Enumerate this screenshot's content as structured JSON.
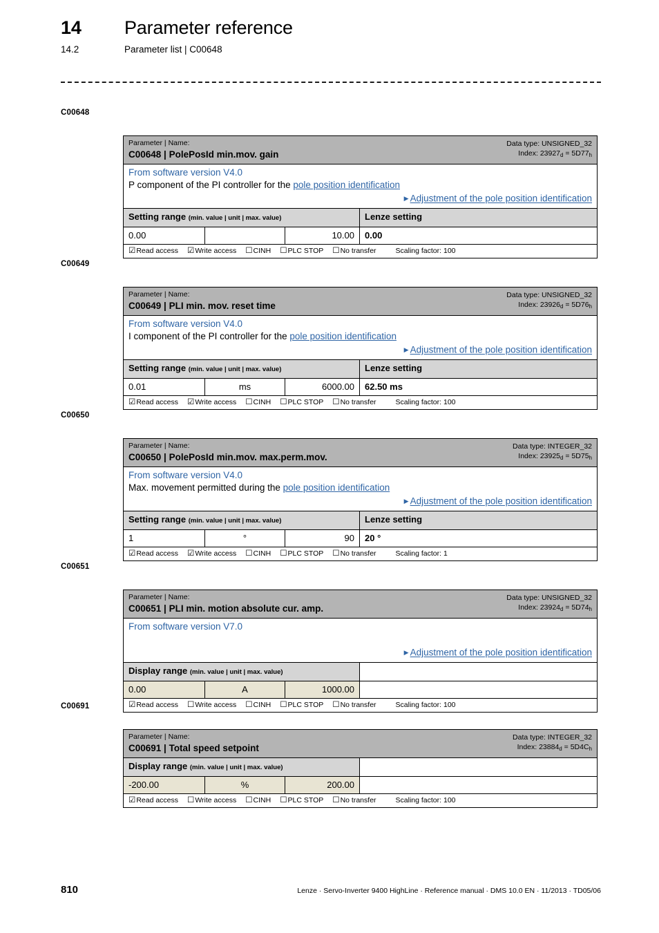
{
  "header": {
    "chapter_number": "14",
    "chapter_title": "Parameter reference",
    "section_number": "14.2",
    "section_title": "Parameter list | C00648"
  },
  "labels": {
    "parameter_name_caption": "Parameter | Name:",
    "setting_range_title": "Setting range",
    "display_range_title": "Display range",
    "range_note": "(min. value | unit | max. value)",
    "lenze_setting_title": "Lenze setting",
    "read_access": "Read access",
    "write_access": "Write access",
    "cinh": "CINH",
    "plc_stop": "PLC STOP",
    "no_transfer": "No transfer",
    "checked_box": "☑",
    "unchecked_box": "☐",
    "link_arrow": "▶"
  },
  "colors": {
    "title_band": "#b4b4b4",
    "range_header": "#d5d5d5",
    "display_range_cell": "#e8e4d3",
    "link_blue": "#2e64a5"
  },
  "parameters": [
    {
      "margin_label": "C00648",
      "code": "C00648",
      "name": "PolePosId min.mov. gain",
      "data_type": "Data type: UNSIGNED_32",
      "index_prefix": "Index: ",
      "index_dec": "23927",
      "index_dec_sub": "d",
      "index_eq": " = ",
      "index_hex": "5D77",
      "index_hex_sub": "h",
      "software_version": "From software version V4.0",
      "description_pre": "P component of the PI controller for the ",
      "description_link": "pole position identification",
      "see_also": "Adjustment of the pole position identification",
      "range_kind": "setting",
      "range_title": "Setting range",
      "min": "0.00",
      "unit": "",
      "max": "10.00",
      "lenze_setting": "0.00",
      "read_access": true,
      "write_access": true,
      "cinh": false,
      "plc_stop": false,
      "no_transfer": false,
      "scaling": "Scaling factor: 100"
    },
    {
      "margin_label": "C00649",
      "code": "C00649",
      "name": "PLI min. mov. reset time",
      "data_type": "Data type: UNSIGNED_32",
      "index_prefix": "Index: ",
      "index_dec": "23926",
      "index_dec_sub": "d",
      "index_eq": " = ",
      "index_hex": "5D76",
      "index_hex_sub": "h",
      "software_version": "From software version V4.0",
      "description_pre": "I component of the PI controller for the ",
      "description_link": "pole position identification",
      "see_also": "Adjustment of the pole position identification",
      "range_kind": "setting",
      "range_title": "Setting range",
      "min": "0.01",
      "unit": "ms",
      "max": "6000.00",
      "lenze_setting": "62.50 ms",
      "read_access": true,
      "write_access": true,
      "cinh": false,
      "plc_stop": false,
      "no_transfer": false,
      "scaling": "Scaling factor: 100"
    },
    {
      "margin_label": "C00650",
      "code": "C00650",
      "name": "PolePosId min.mov. max.perm.mov.",
      "data_type": "Data type: INTEGER_32",
      "index_prefix": "Index: ",
      "index_dec": "23925",
      "index_dec_sub": "d",
      "index_eq": " = ",
      "index_hex": "5D75",
      "index_hex_sub": "h",
      "software_version": "From software version V4.0",
      "description_pre": "Max. movement permitted during the ",
      "description_link": "pole position identification",
      "see_also": "Adjustment of the pole position identification",
      "range_kind": "setting",
      "range_title": "Setting range",
      "min": "1",
      "unit": "°",
      "max": "90",
      "lenze_setting": "20 °",
      "read_access": true,
      "write_access": true,
      "cinh": false,
      "plc_stop": false,
      "no_transfer": false,
      "scaling": "Scaling factor: 1"
    },
    {
      "margin_label": "C00651",
      "code": "C00651",
      "name": "PLI min. motion absolute cur. amp.",
      "data_type": "Data type: UNSIGNED_32",
      "index_prefix": "Index: ",
      "index_dec": "23924",
      "index_dec_sub": "d",
      "index_eq": " = ",
      "index_hex": "5D74",
      "index_hex_sub": "h",
      "software_version": "From software version V7.0",
      "description_pre": "",
      "description_link": "",
      "see_also": "Adjustment of the pole position identification",
      "range_kind": "display",
      "range_title": "Display range",
      "min": "0.00",
      "unit": "A",
      "max": "1000.00",
      "lenze_setting": "",
      "read_access": true,
      "write_access": false,
      "cinh": false,
      "plc_stop": false,
      "no_transfer": false,
      "scaling": "Scaling factor: 100"
    },
    {
      "margin_label": "C00691",
      "code": "C00691",
      "name": "Total speed setpoint",
      "data_type": "Data type: INTEGER_32",
      "index_prefix": "Index: ",
      "index_dec": "23884",
      "index_dec_sub": "d",
      "index_eq": " = ",
      "index_hex": "5D4C",
      "index_hex_sub": "h",
      "software_version": "",
      "description_pre": "",
      "description_link": "",
      "see_also": "",
      "range_kind": "display",
      "range_title": "Display range",
      "min": "-200.00",
      "unit": "%",
      "max": "200.00",
      "lenze_setting": "",
      "read_access": true,
      "write_access": false,
      "cinh": false,
      "plc_stop": false,
      "no_transfer": false,
      "scaling": "Scaling factor: 100"
    }
  ],
  "footer": {
    "page_number": "810",
    "credit": "Lenze · Servo-Inverter 9400 HighLine · Reference manual · DMS 10.0 EN · 11/2013 · TD05/06"
  }
}
